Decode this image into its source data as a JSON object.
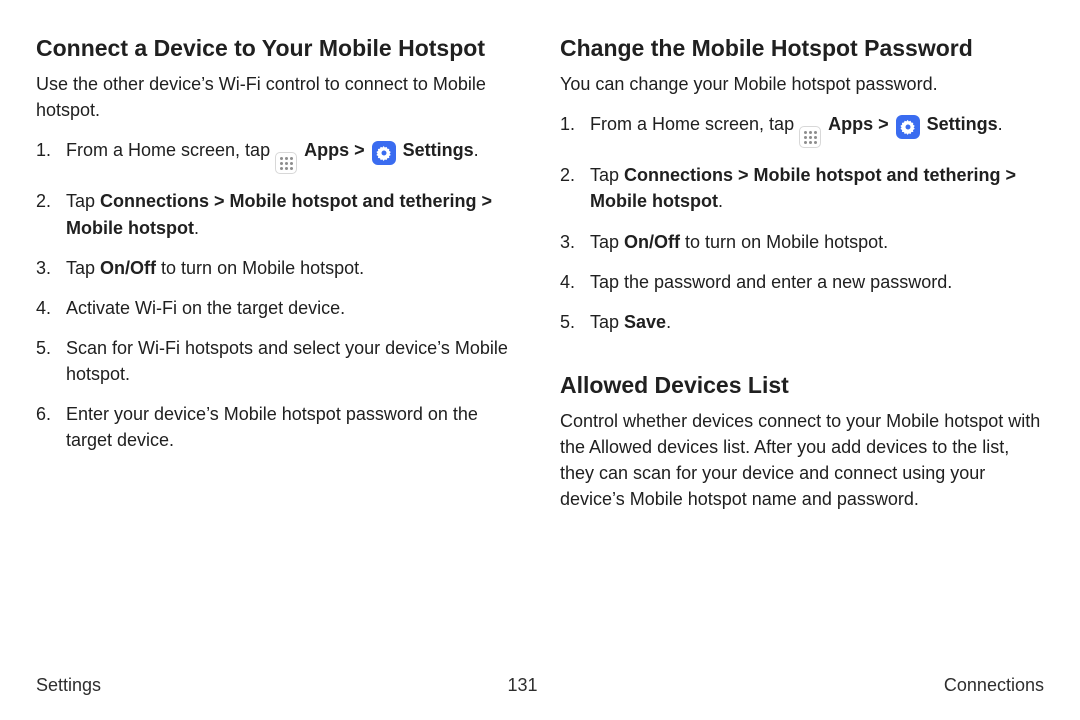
{
  "left": {
    "h1": "Connect a Device to Your Mobile Hotspot",
    "intro": "Use the other device’s Wi-Fi control to connect to Mobile hotspot.",
    "steps": {
      "s1_pre": "From a Home screen, tap ",
      "apps_label": "Apps",
      "sep": " > ",
      "settings_label": "Settings",
      "s1_post": ".",
      "s2_pre": "Tap ",
      "s2_bold": "Connections > Mobile hotspot and tethering > Mobile hotspot",
      "s2_post": ".",
      "s3_pre": "Tap ",
      "s3_bold": "On/Off",
      "s3_post": " to turn on Mobile hotspot.",
      "s4": "Activate Wi-Fi on the target device.",
      "s5": "Scan for Wi-Fi hotspots and select your device’s Mobile hotspot.",
      "s6": "Enter your device’s Mobile hotspot password on the target device."
    }
  },
  "right": {
    "h1": "Change the Mobile Hotspot Password",
    "intro": "You can change your Mobile hotspot password.",
    "steps": {
      "s1_pre": "From a Home screen, tap ",
      "apps_label": "Apps",
      "sep": " > ",
      "settings_label": "Settings",
      "s1_post": ".",
      "s2_pre": "Tap ",
      "s2_bold": "Connections > Mobile hotspot and tethering > Mobile hotspot",
      "s2_post": ".",
      "s3_pre": "Tap ",
      "s3_bold": "On/Off",
      "s3_post": " to turn on Mobile hotspot.",
      "s4": "Tap the password and enter a new password.",
      "s5_pre": "Tap ",
      "s5_bold": "Save",
      "s5_post": "."
    },
    "h2": "Allowed Devices List",
    "intro2": "Control whether devices connect to your Mobile hotspot with the Allowed devices list. After you add devices to the list, they can scan for your device and connect using your device’s Mobile hotspot name and password."
  },
  "footer": {
    "left": "Settings",
    "center": "131",
    "right": "Connections"
  }
}
